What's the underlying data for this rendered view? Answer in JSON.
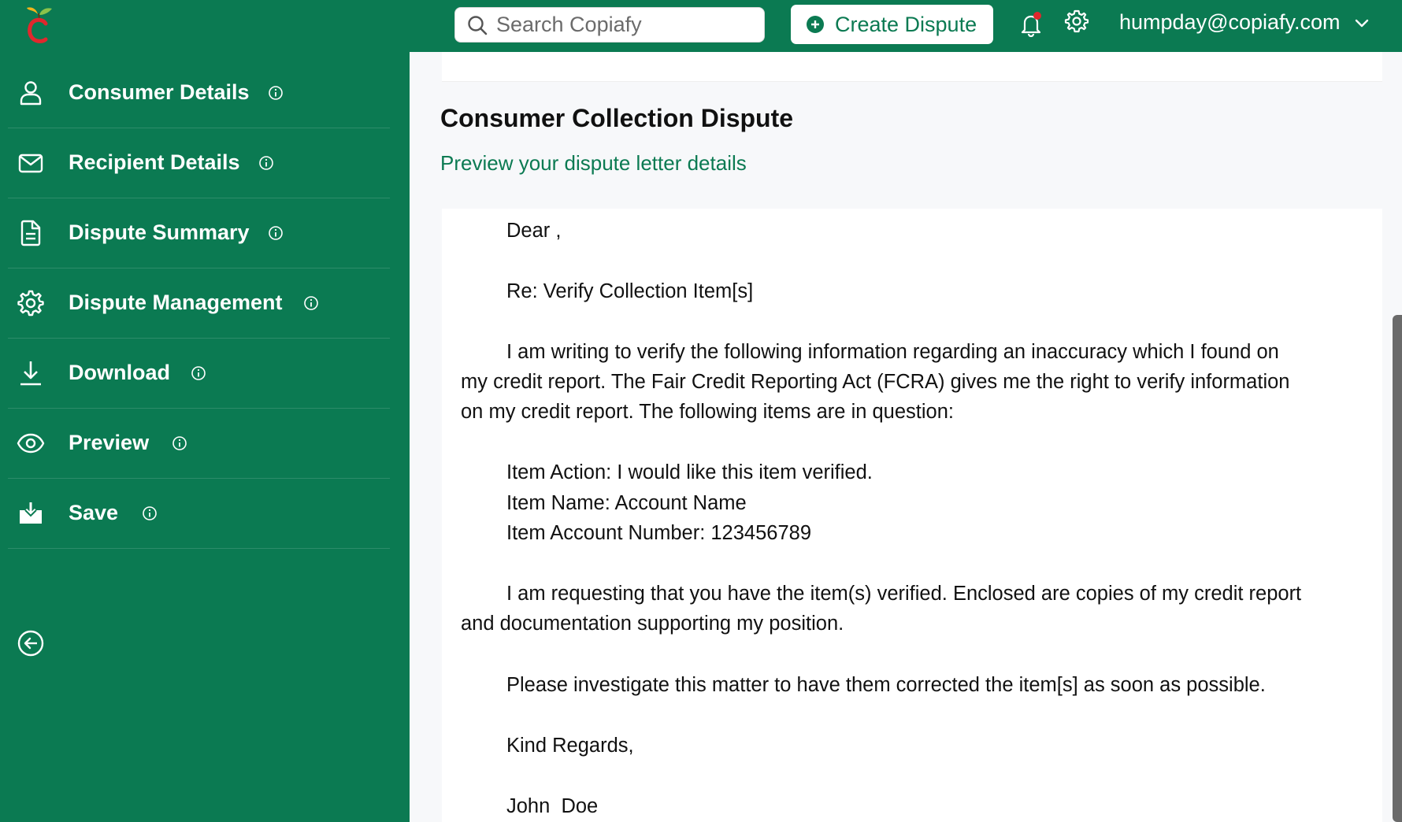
{
  "header": {
    "search_placeholder": "Search Copiafy",
    "create_button": "Create Dispute",
    "account_email": "humpday@copiafy.com",
    "icons": [
      "copiafy-logo",
      "search-icon",
      "plus-circle-icon",
      "bell-icon",
      "gear-icon",
      "chevron-down-icon"
    ],
    "notification_dot_color": "#e0282d"
  },
  "sidebar": {
    "items": [
      {
        "label": "Consumer Details",
        "icon": "user-icon"
      },
      {
        "label": "Recipient Details",
        "icon": "mail-icon"
      },
      {
        "label": "Dispute Summary",
        "icon": "document-icon"
      },
      {
        "label": "Dispute Management",
        "icon": "gear-icon"
      },
      {
        "label": "Download",
        "icon": "download-icon"
      },
      {
        "label": "Preview",
        "icon": "eye-icon"
      },
      {
        "label": "Save",
        "icon": "save-icon"
      }
    ],
    "collapse_icon": "arrow-left-circle-icon"
  },
  "main": {
    "title": "Consumer Collection Dispute",
    "subtitle": "Preview your dispute letter details",
    "letter": {
      "greeting": "Dear ,",
      "subject": "Re: Verify Collection Item[s]",
      "para1_line1": "I am writing to verify the following information regarding an inaccuracy which I found on",
      "para1_line2": "my credit report. The Fair Credit Reporting Act (FCRA) gives me the right to verify information",
      "para1_line3": "on my credit report. The following items are in question:",
      "item_action": "Item Action: I would like this item verified.",
      "item_name": "Item Name: Account Name",
      "item_account": "Item Account Number: 123456789",
      "para2_line1": "I am requesting that you have the item(s) verified. Enclosed are copies of my credit report",
      "para2_line2": "and documentation supporting my position.",
      "para3": "Please investigate this matter to have them corrected the item[s] as soon as possible.",
      "closing": "Kind Regards,",
      "signature": "John  Doe"
    }
  },
  "colors": {
    "brand_green": "#0b7a52",
    "background": "#f7f8fa",
    "text": "#111111"
  }
}
